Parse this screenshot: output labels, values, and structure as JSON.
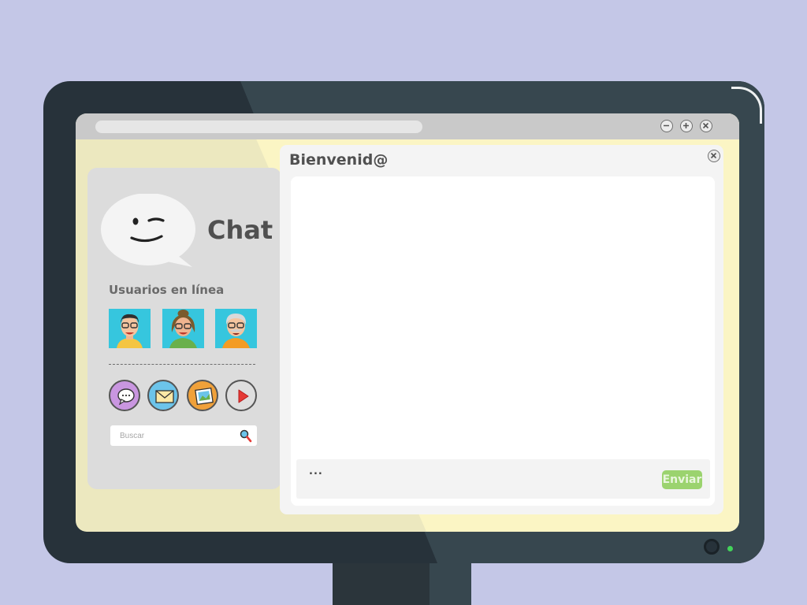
{
  "chat": {
    "title": "Chat",
    "online_users_heading": "Usuarios en línea",
    "users": [
      {
        "id": "user-1",
        "hair": "#2f2f2f",
        "shirt": "#f4c542"
      },
      {
        "id": "user-2",
        "hair": "#7a5a2c",
        "shirt": "#6ab04c"
      },
      {
        "id": "user-3",
        "hair": "#d9d9d9",
        "shirt": "#f39c24"
      }
    ],
    "actions": [
      {
        "id": "chat",
        "icon": "speech-bubble-icon",
        "color": "#c996e0"
      },
      {
        "id": "mail",
        "icon": "envelope-icon",
        "color": "#6cc4ea"
      },
      {
        "id": "photos",
        "icon": "image-icon",
        "color": "#f0a13a"
      },
      {
        "id": "video",
        "icon": "play-icon",
        "color": "#dedede"
      }
    ],
    "search": {
      "placeholder": "Buscar"
    }
  },
  "window": {
    "title": "Bienvenid@",
    "compose_text": "...",
    "send_label": "Enviar"
  },
  "colors": {
    "background": "#c4c7e7",
    "monitor": "#27323a",
    "screen": "#ece8bf",
    "send_button": "#9bd36e",
    "power_led": "#43d35a"
  }
}
